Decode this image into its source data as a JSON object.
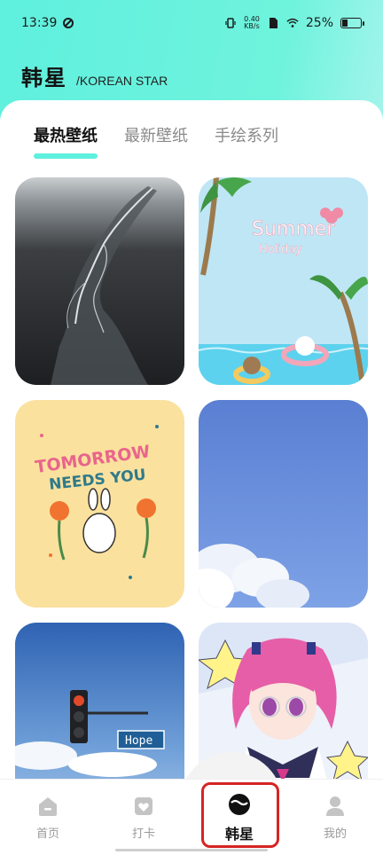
{
  "status_bar": {
    "time": "13:39",
    "net_speed_value": "0.40",
    "net_speed_unit": "KB/s",
    "battery": "25%",
    "battery_level": 0.25
  },
  "header": {
    "title": "韩星",
    "subtitle": "/KOREAN STAR"
  },
  "tabs": [
    {
      "label": "最热壁纸",
      "active": true
    },
    {
      "label": "最新壁纸",
      "active": false
    },
    {
      "label": "手绘系列",
      "active": false
    }
  ],
  "wallpapers": [
    {
      "icon": "aerial-river-landscape"
    },
    {
      "text": "Summer",
      "subtext": "Holiday"
    },
    {
      "lines": [
        "TOMORROW",
        "NEEDS YOU"
      ]
    },
    {
      "icon": "blue-sky-clouds"
    },
    {
      "sign": "Hope"
    },
    {
      "icon": "anime-girl-illustration"
    }
  ],
  "bottom_nav": [
    {
      "label": "首页",
      "icon": "home-icon",
      "active": false
    },
    {
      "label": "打卡",
      "icon": "checkin-icon",
      "active": false
    },
    {
      "label": "韩星",
      "icon": "star-icon",
      "active": true
    },
    {
      "label": "我的",
      "icon": "profile-icon",
      "active": false
    }
  ],
  "colors": {
    "accent": "#5ff0de",
    "highlight_border": "#d62424"
  }
}
